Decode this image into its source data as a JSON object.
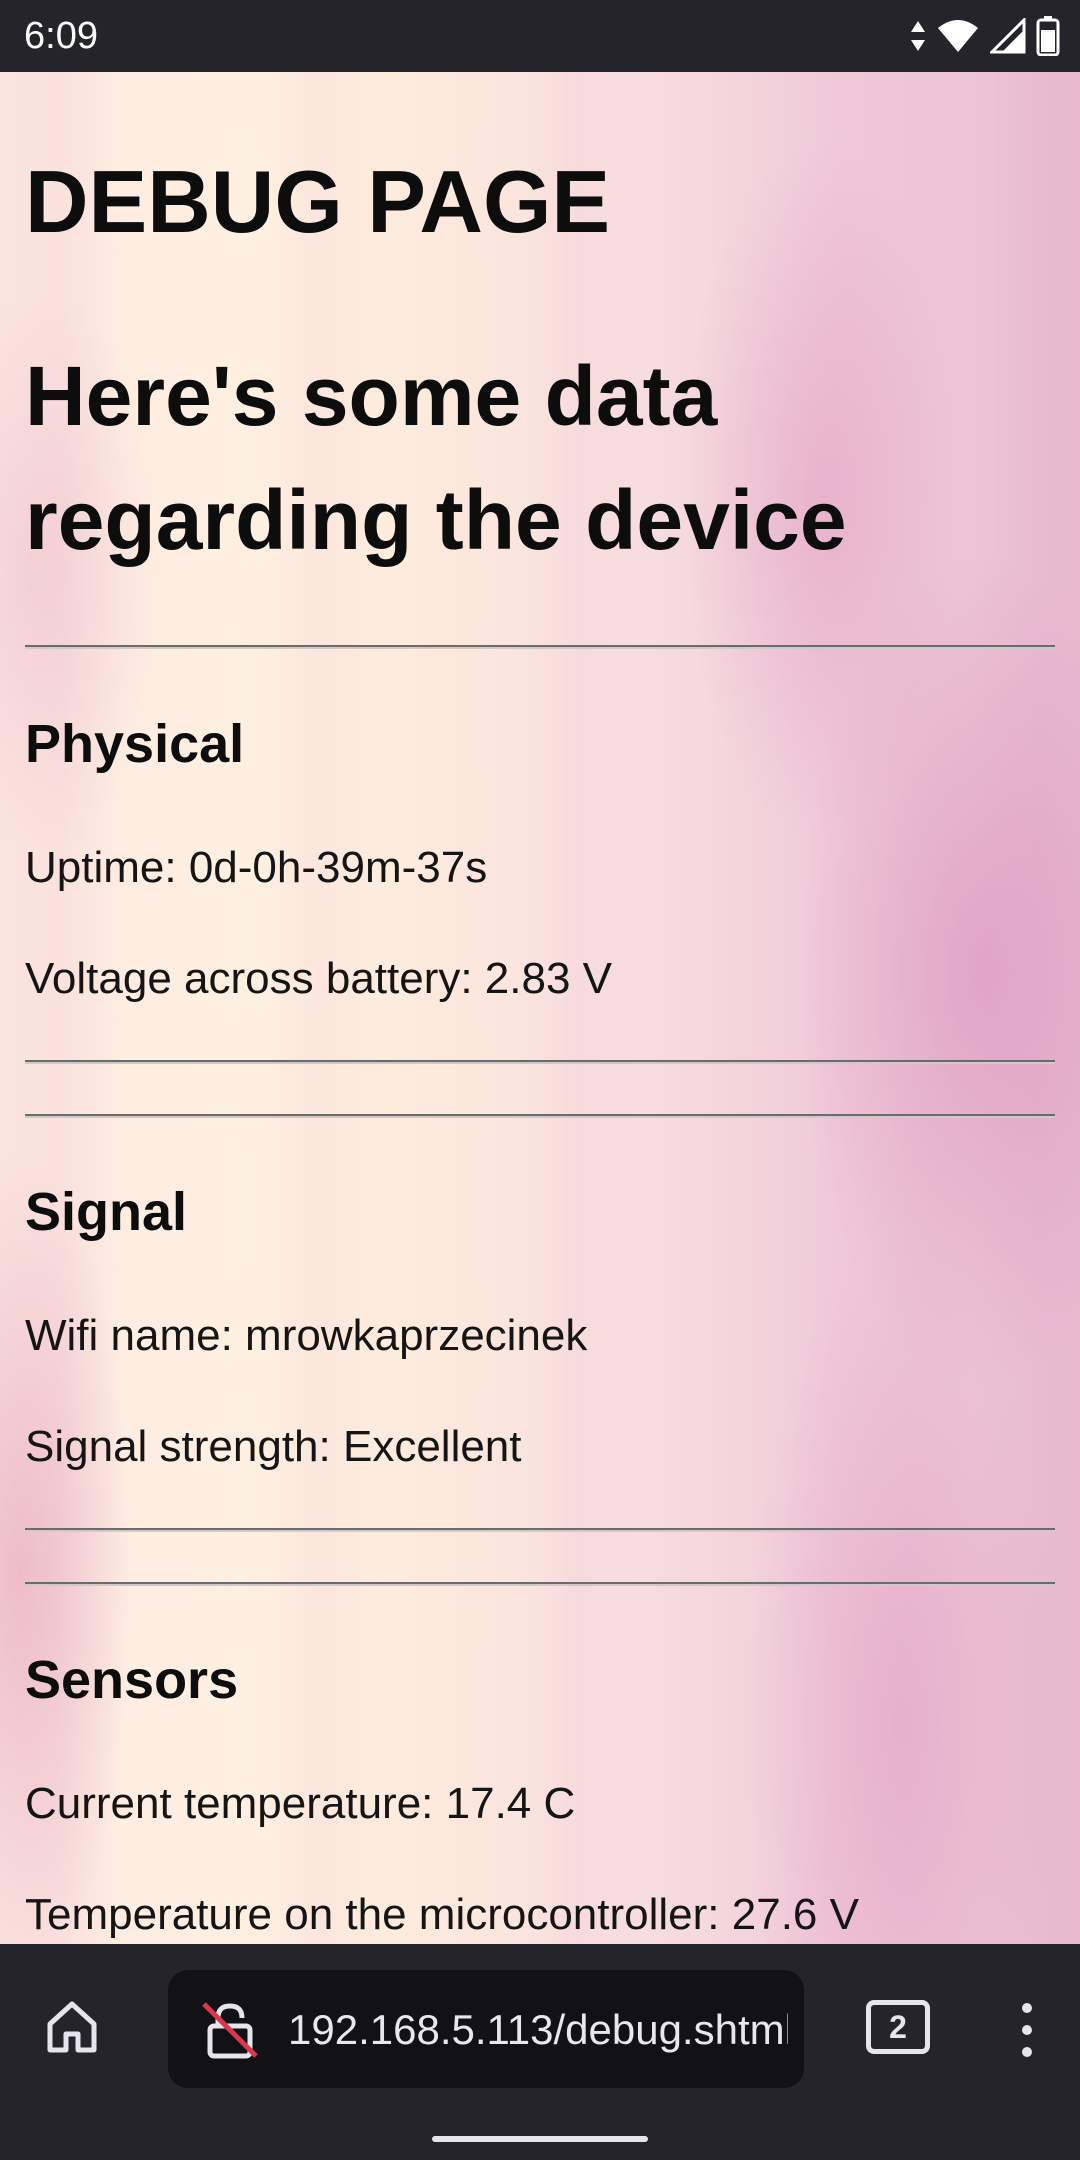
{
  "status_bar": {
    "time": "6:09",
    "icons": [
      "data-arrows-icon",
      "wifi-icon",
      "cell-signal-icon",
      "battery-icon"
    ]
  },
  "page": {
    "title": "DEBUG PAGE",
    "subtitle": "Here's some data regarding the device",
    "sections": [
      {
        "heading": "Physical",
        "rows": [
          "Uptime: 0d-0h-39m-37s",
          "Voltage across battery: 2.83 V"
        ]
      },
      {
        "heading": "Signal",
        "rows": [
          "Wifi name: mrowkaprzecinek",
          "Signal strength: Excellent"
        ]
      },
      {
        "heading": "Sensors",
        "rows": [
          "Current temperature: 17.4 C",
          "Temperature on the microcontroller: 27.6 V"
        ]
      }
    ]
  },
  "browser_bar": {
    "home_icon": "home-icon",
    "security_icon": "not-secure-lock-icon",
    "url": "192.168.5.113/debug.shtml",
    "tab_count": "2",
    "menu_icon": "more-vert-icon"
  },
  "colors": {
    "system_bar": "#25242b",
    "url_box": "#121116",
    "text": "#111111",
    "insecure_slash": "#e0344a"
  }
}
